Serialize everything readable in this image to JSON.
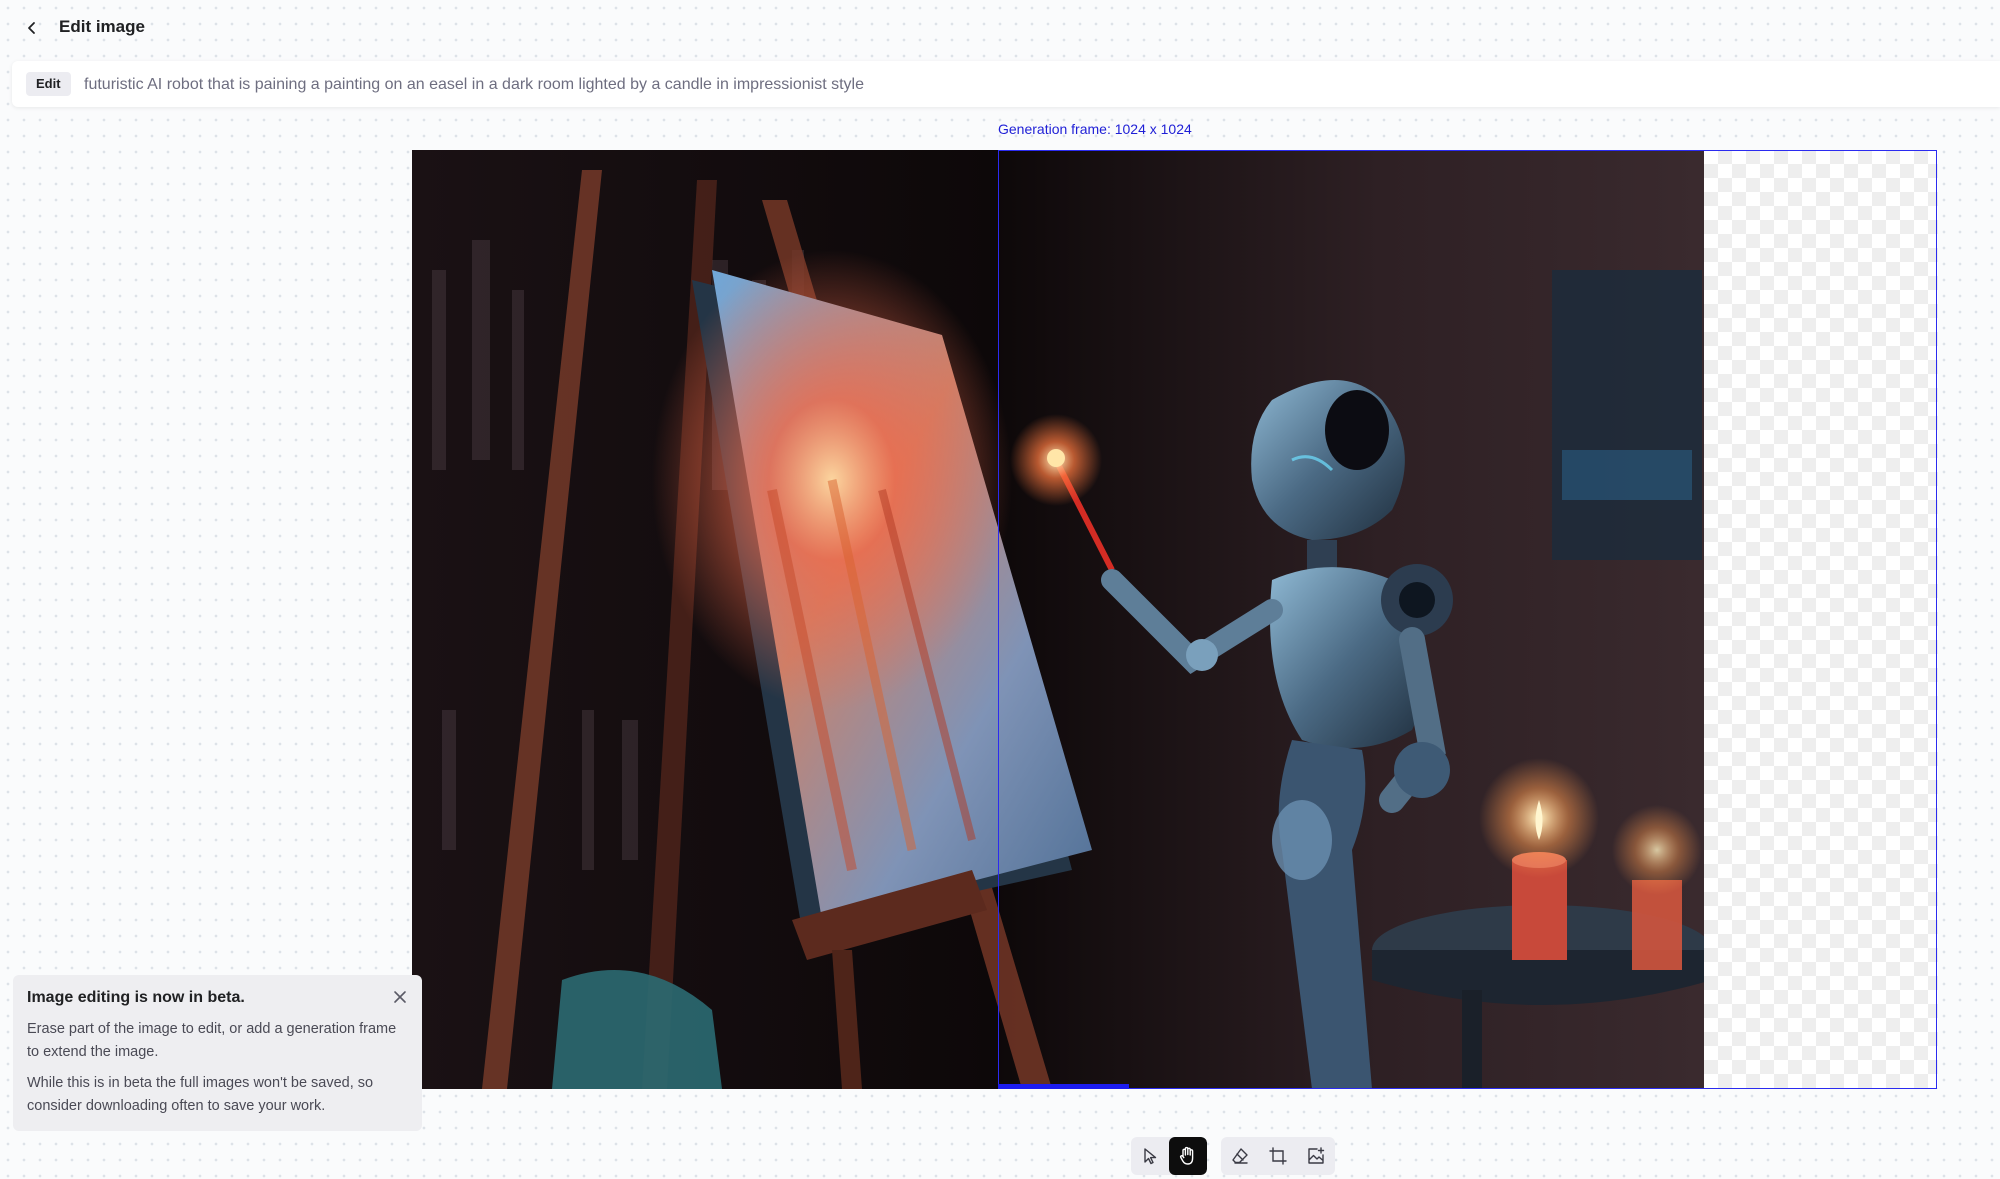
{
  "header": {
    "title": "Edit image"
  },
  "prompt": {
    "badge": "Edit",
    "value": "futuristic AI robot that is paining a painting on an easel in a dark room lighted by a candle in impressionist style"
  },
  "generation_frame": {
    "label": "Generation frame: 1024 x 1024",
    "progress": 0.14
  },
  "beta_notice": {
    "title": "Image editing is now in beta.",
    "paragraph1": "Erase part of the image to edit, or add a generation frame to extend the image.",
    "paragraph2": "While this is in beta the full images won't be saved, so consider downloading often to save your work."
  },
  "toolbar": {
    "tools": [
      {
        "icon": "select-cursor-icon",
        "active": false
      },
      {
        "icon": "hand-pan-icon",
        "active": true
      },
      {
        "icon": "eraser-icon",
        "active": false
      },
      {
        "icon": "generation-frame-icon",
        "active": false
      },
      {
        "icon": "upload-image-icon",
        "active": false
      }
    ]
  },
  "colors": {
    "frame_border": "#2b2bf0",
    "frame_label": "#1f1fd6",
    "active_tool": "#0d0d0d"
  }
}
